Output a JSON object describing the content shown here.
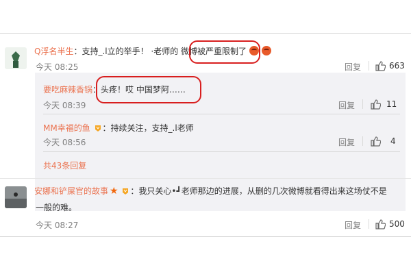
{
  "comments": [
    {
      "user": "Q浮名半生",
      "text": "：支持_.l立的举手！ ·老师的 微博被严重限制了",
      "time": "今天 08:25",
      "reply_label": "回复",
      "likes": "663"
    },
    {
      "user": "安娜和铲屎官的故事",
      "text_line1": "：我只关心•┛老师那边的进展，从删的几次微博就看得出来这场仗不是",
      "text_line2": "一般的难。",
      "time": "今天 08:27",
      "reply_label": "回复",
      "likes": "500"
    }
  ],
  "replies": [
    {
      "user": "要吃麻辣香锅",
      "text": "：头疼！哎 中国梦阿……",
      "time": "今天 08:39",
      "reply_label": "回复",
      "likes": "11"
    },
    {
      "user": "MM幸福的鱼",
      "text": "：持续关注，支持_.l老师",
      "time": "今天 08:56",
      "reply_label": "回复",
      "likes": "4"
    }
  ],
  "more_replies": "共43条回复",
  "colors": {
    "username": "#eb7350",
    "highlight_box": "#d81e1e"
  },
  "icons": [
    "thumbs-up-icon",
    "vip-badge-icon",
    "angry-emoji-icon",
    "star-icon"
  ]
}
